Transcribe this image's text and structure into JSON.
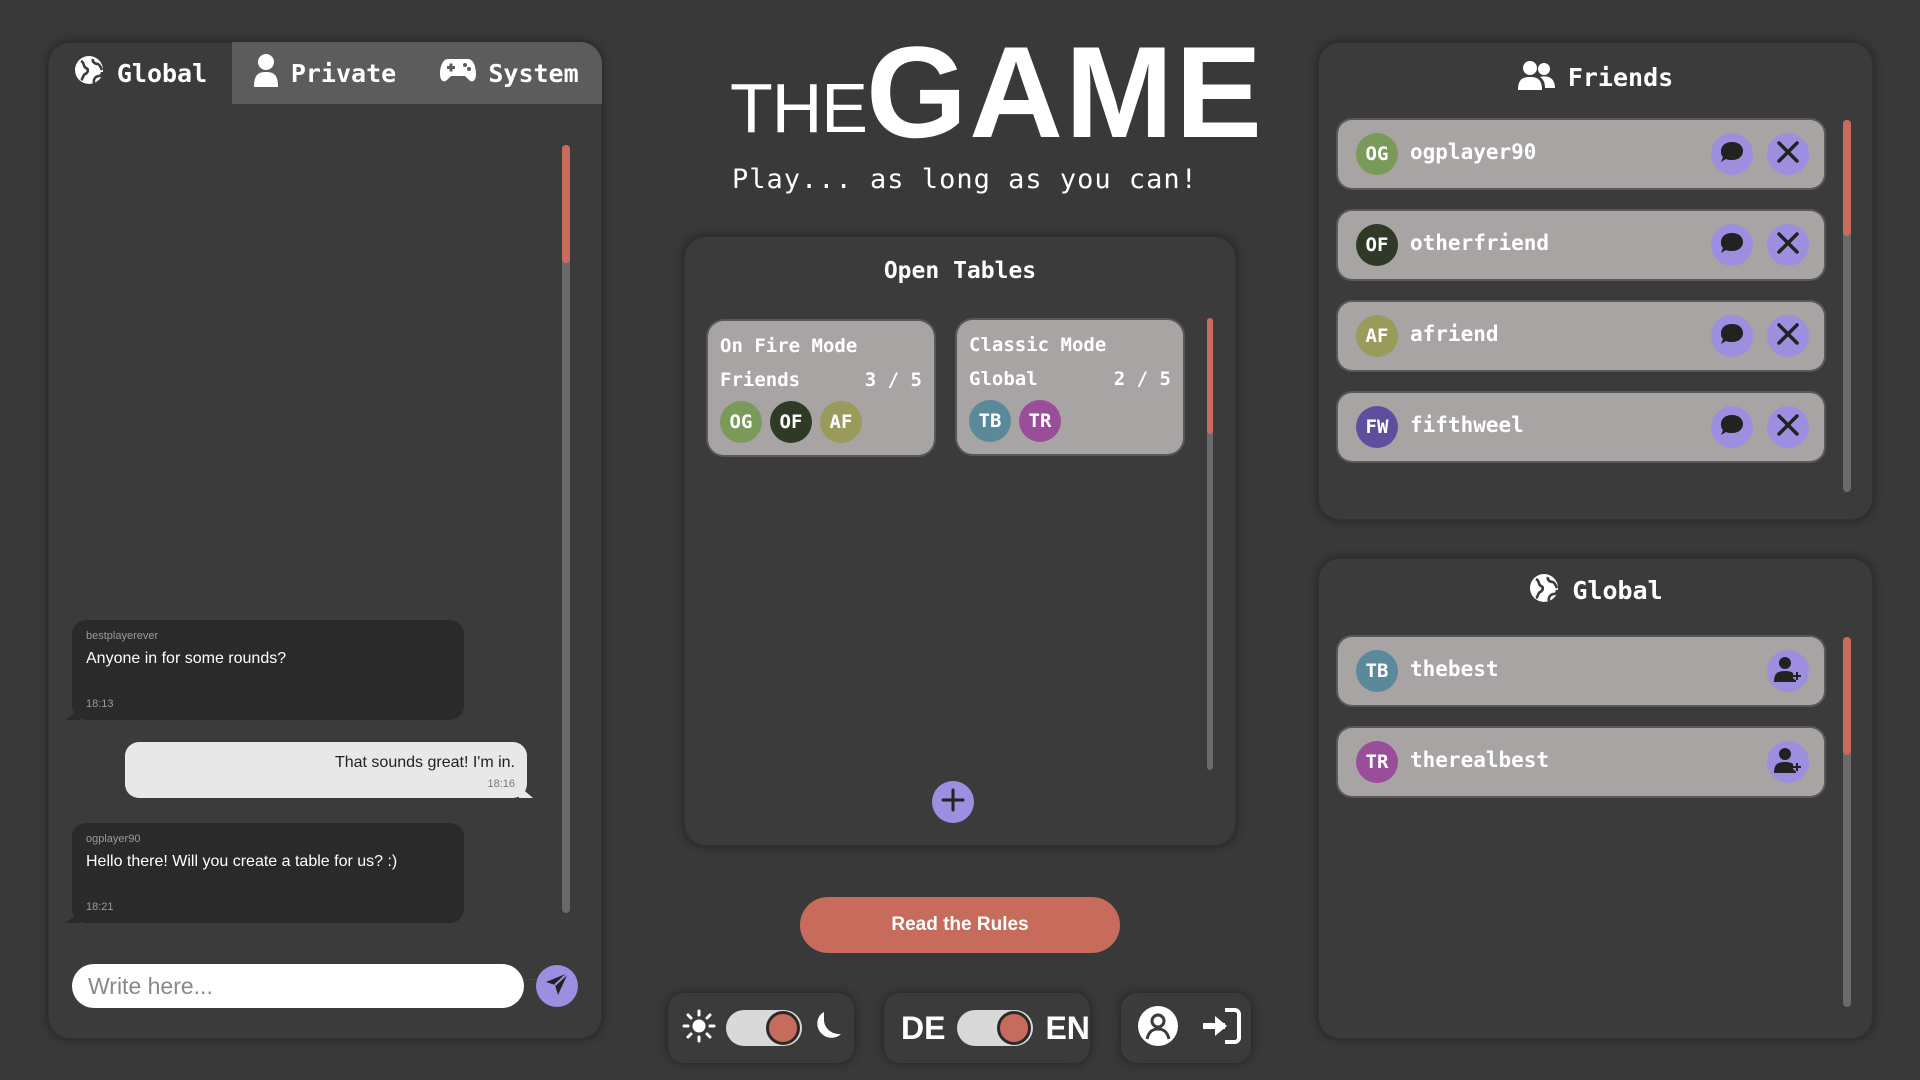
{
  "chat": {
    "tabs": [
      {
        "label": "Global",
        "icon": "globe-icon"
      },
      {
        "label": "Private",
        "icon": "person-icon"
      },
      {
        "label": "System",
        "icon": "gamepad-icon"
      }
    ],
    "messages": [
      {
        "author": "bestplayerever",
        "text": "Anyone in for some rounds?",
        "time": "18:13",
        "direction": "in"
      },
      {
        "author": "",
        "text": "That sounds great! I'm in.",
        "time": "18:16",
        "direction": "out"
      },
      {
        "author": "ogplayer90",
        "text": "Hello there! Will you create a table for us? :)",
        "time": "18:21",
        "direction": "in"
      }
    ],
    "input_placeholder": "Write here..."
  },
  "header": {
    "logo_the": "THE",
    "logo_game": "GAME",
    "tagline": "Play... as long as you can!"
  },
  "tables": {
    "title": "Open Tables",
    "items": [
      {
        "mode": "On Fire Mode",
        "scope": "Friends",
        "count": "3 / 5",
        "players": [
          "OG",
          "OF",
          "AF"
        ]
      },
      {
        "mode": "Classic Mode",
        "scope": "Global",
        "count": "2 / 5",
        "players": [
          "TB",
          "TR"
        ]
      }
    ]
  },
  "rules_button": "Read the Rules",
  "language": {
    "left": "DE",
    "right": "EN"
  },
  "friends": {
    "title": "Friends",
    "items": [
      {
        "initials": "OG",
        "name": "ogplayer90"
      },
      {
        "initials": "OF",
        "name": "otherfriend"
      },
      {
        "initials": "AF",
        "name": "afriend"
      },
      {
        "initials": "FW",
        "name": "fifthweel"
      }
    ]
  },
  "global_users": {
    "title": "Global",
    "items": [
      {
        "initials": "TB",
        "name": "thebest"
      },
      {
        "initials": "TR",
        "name": "therealbest"
      }
    ]
  },
  "colors": {
    "background": "#3a3939",
    "accent": "#c76b5c",
    "button": "#9d8ee0",
    "card": "#a8a4a3",
    "avatar_OG": "#7a9a5a",
    "avatar_OF": "#2f3a26",
    "avatar_AF": "#9a9a5a",
    "avatar_FW": "#5e4e9e",
    "avatar_TB": "#5a8a9a",
    "avatar_TR": "#9a4e9a"
  }
}
